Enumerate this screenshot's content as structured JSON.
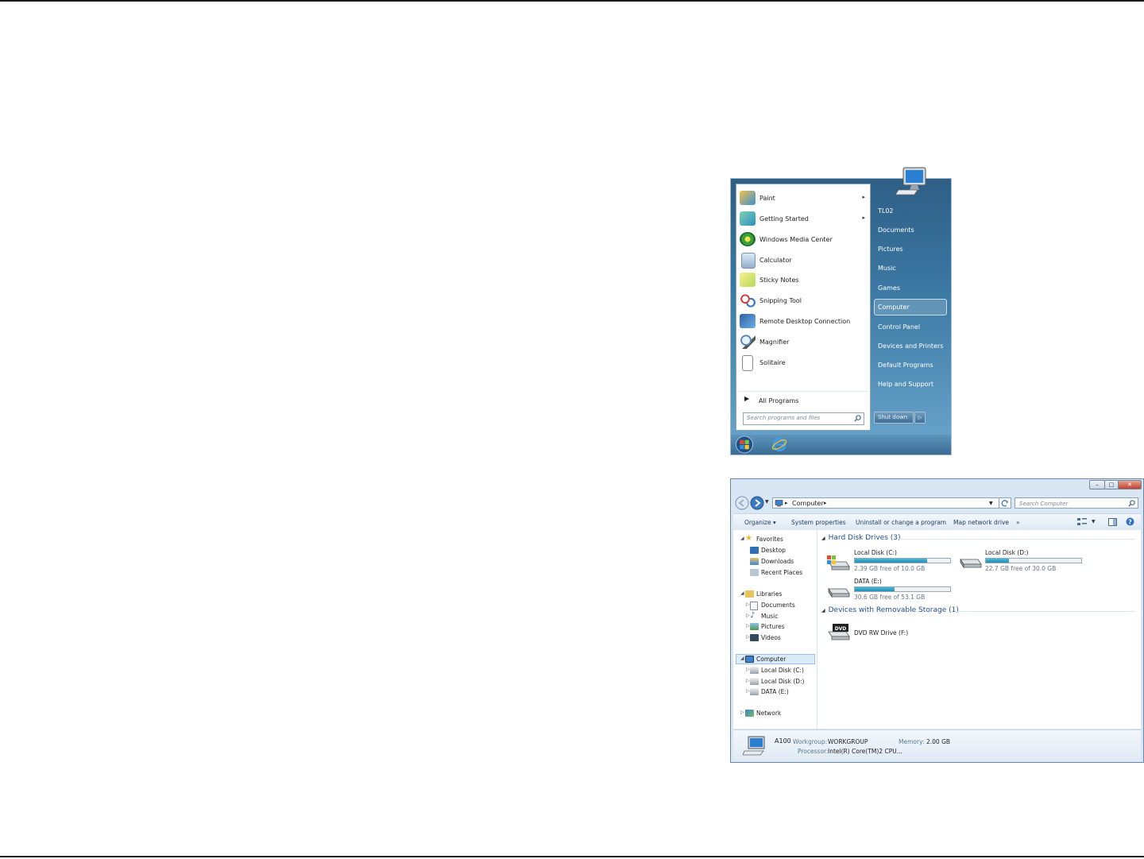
{
  "start_menu": {
    "programs": [
      {
        "label": "Paint",
        "icon": "paint-icon",
        "has_submenu": true
      },
      {
        "label": "Getting Started",
        "icon": "getting-started-icon",
        "has_submenu": true
      },
      {
        "label": "Windows Media Center",
        "icon": "media-center-icon",
        "has_submenu": false
      },
      {
        "label": "Calculator",
        "icon": "calculator-icon",
        "has_submenu": false
      },
      {
        "label": "Sticky Notes",
        "icon": "sticky-notes-icon",
        "has_submenu": false
      },
      {
        "label": "Snipping Tool",
        "icon": "snipping-tool-icon",
        "has_submenu": false
      },
      {
        "label": "Remote Desktop Connection",
        "icon": "remote-desktop-icon",
        "has_submenu": false
      },
      {
        "label": "Magnifier",
        "icon": "magnifier-icon",
        "has_submenu": false
      },
      {
        "label": "Solitaire",
        "icon": "solitaire-icon",
        "has_submenu": false
      }
    ],
    "all_programs": "All Programs",
    "search_placeholder": "Search programs and files",
    "right_links": [
      "TL02",
      "Documents",
      "Pictures",
      "Music",
      "Games",
      "Computer",
      "Control Panel",
      "Devices and Printers",
      "Default Programs",
      "Help and Support"
    ],
    "highlighted": "Computer",
    "shutdown_label": "Shut down",
    "submenu_arrow": "▸",
    "shutdown_arrow": "▷"
  },
  "explorer": {
    "address": [
      "Computer"
    ],
    "search_placeholder": "Search Computer",
    "toolbar": {
      "organize": "Organize ▾",
      "system_properties": "System properties",
      "uninstall": "Uninstall or change a program",
      "map_drive": "Map network drive",
      "more": "»"
    },
    "nav": {
      "favorites": "Favorites",
      "favorites_items": [
        "Desktop",
        "Downloads",
        "Recent Places"
      ],
      "libraries": "Libraries",
      "libraries_items": [
        "Documents",
        "Music",
        "Pictures",
        "Videos"
      ],
      "computer": "Computer",
      "computer_items": [
        "Local Disk (C:)",
        "Local Disk (D:)",
        "DATA (E:)"
      ],
      "network": "Network"
    },
    "groups": {
      "hdd": "Hard Disk Drives (3)",
      "removable": "Devices with Removable Storage (1)"
    },
    "drives": [
      {
        "name": "Local Disk (C:)",
        "free_text": "2.39 GB free of 10.0 GB",
        "used_fraction": 0.76
      },
      {
        "name": "Local Disk (D:)",
        "free_text": "22.7 GB free of 30.0 GB",
        "used_fraction": 0.24
      },
      {
        "name": "DATA (E:)",
        "free_text": "30.6 GB free of 53.1 GB",
        "used_fraction": 0.42
      }
    ],
    "dvd": {
      "name": "DVD RW Drive (F:)",
      "badge": "DVD"
    },
    "details": {
      "name": "A100",
      "workgroup_label": "Workgroup:",
      "workgroup": "WORKGROUP",
      "memory_label": "Memory:",
      "memory": "2.00 GB",
      "processor_label": "Processor:",
      "processor": "Intel(R) Core(TM)2 CPU..."
    }
  },
  "colors": {
    "accent": "#1e4f9c",
    "bar_fill": "#2a9dc2"
  }
}
